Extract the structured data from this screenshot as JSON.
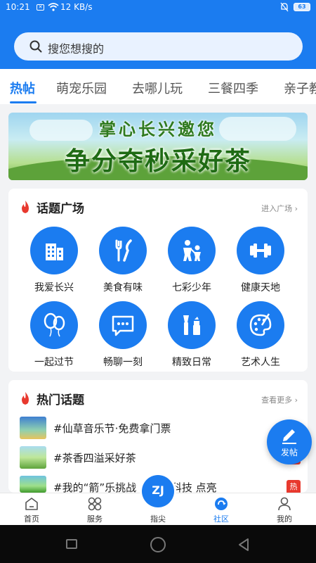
{
  "status_bar": {
    "time": "10:21",
    "speed": "12 KB/s",
    "battery": "63"
  },
  "search": {
    "placeholder": "搜您想搜的"
  },
  "tabs": [
    {
      "label": "热帖",
      "active": true
    },
    {
      "label": "萌宠乐园"
    },
    {
      "label": "去哪儿玩"
    },
    {
      "label": "三餐四季"
    },
    {
      "label": "亲子教"
    }
  ],
  "banner": {
    "line1": "掌心长兴邀您",
    "line2": "争分夺秒采好茶"
  },
  "topic_square": {
    "title": "话题广场",
    "more": "进入广场",
    "items": [
      {
        "label": "我爱长兴",
        "icon": "building-icon"
      },
      {
        "label": "美食有味",
        "icon": "fork-knife-icon"
      },
      {
        "label": "七彩少年",
        "icon": "family-icon"
      },
      {
        "label": "健康天地",
        "icon": "dumbbell-icon"
      },
      {
        "label": "一起过节",
        "icon": "balloon-icon"
      },
      {
        "label": "畅聊一刻",
        "icon": "chat-icon"
      },
      {
        "label": "精致日常",
        "icon": "cosmetics-icon"
      },
      {
        "label": "艺术人生",
        "icon": "palette-icon"
      }
    ]
  },
  "hot_topics": {
    "title": "热门话题",
    "more": "查看更多",
    "items": [
      {
        "text": "#仙草音乐节·免费拿门票",
        "tag": ""
      },
      {
        "text": "#茶香四溢采好茶",
        "tag": "热"
      },
      {
        "text": "#我的“箭”乐挑战 「探索科技 点亮",
        "tag": "热"
      }
    ]
  },
  "float_button": {
    "label": "发帖"
  },
  "bottom_nav": [
    {
      "label": "首页"
    },
    {
      "label": "服务"
    },
    {
      "label": "指尖"
    },
    {
      "label": "社区",
      "active": true
    },
    {
      "label": "我的"
    }
  ],
  "colors": {
    "primary": "#1b7cf0",
    "hot_red": "#e8392e"
  }
}
